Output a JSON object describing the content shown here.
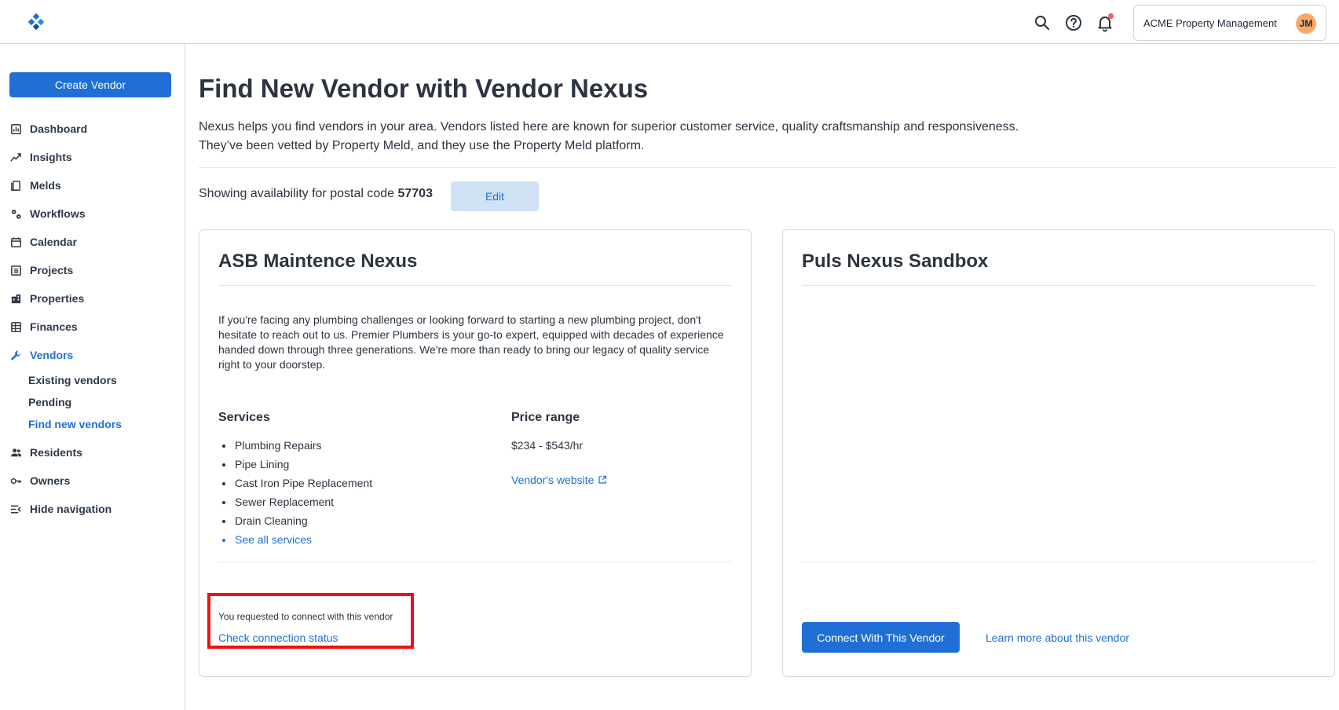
{
  "header": {
    "logo_icon": "property-meld-logo",
    "account_name": "ACME Property Management",
    "avatar_initials": "JM",
    "icons": [
      "search-icon",
      "help-icon",
      "bell-icon"
    ]
  },
  "sidebar": {
    "create_label": "Create Vendor",
    "items": [
      {
        "label": "Dashboard",
        "icon": "dashboard-icon"
      },
      {
        "label": "Insights",
        "icon": "insights-icon"
      },
      {
        "label": "Melds",
        "icon": "melds-icon"
      },
      {
        "label": "Workflows",
        "icon": "workflows-icon"
      },
      {
        "label": "Calendar",
        "icon": "calendar-icon"
      },
      {
        "label": "Projects",
        "icon": "projects-icon"
      },
      {
        "label": "Properties",
        "icon": "properties-icon"
      },
      {
        "label": "Finances",
        "icon": "finances-icon"
      },
      {
        "label": "Vendors",
        "icon": "wrench-icon"
      },
      {
        "label": "Residents",
        "icon": "residents-icon"
      },
      {
        "label": "Owners",
        "icon": "key-icon"
      },
      {
        "label": "Hide navigation",
        "icon": "hide-nav-icon"
      }
    ],
    "vendor_sub": [
      "Existing vendors",
      "Pending",
      "Find new vendors"
    ]
  },
  "main": {
    "title": "Find New Vendor with Vendor Nexus",
    "intro_line1": "Nexus helps you find vendors in your area. Vendors listed here are known for superior customer service, quality craftsmanship and responsiveness.",
    "intro_line2": "They’ve been vetted by Property Meld, and they use the Property Meld platform.",
    "postal_prefix": "Showing availability for postal code ",
    "postal_code": "57703",
    "edit_label": "Edit"
  },
  "cards": [
    {
      "title": "ASB Maintence Nexus",
      "description": "If you're facing any plumbing challenges or looking forward to starting a new plumbing project, don't hesitate to reach out to us. Premier Plumbers is your go-to expert, equipped with decades of experience handed down through three generations. We're more than ready to bring our legacy of quality service right to your doorstep.",
      "services_heading": "Services",
      "services": [
        "Plumbing Repairs",
        "Pipe Lining",
        "Cast Iron Pipe Replacement",
        "Sewer Replacement",
        "Drain Cleaning"
      ],
      "see_all": "See all services",
      "price_heading": "Price range",
      "price": "$234 - $543/hr",
      "website_label": "Vendor's website",
      "request_text": "You requested to connect with this vendor",
      "status_link": "Check connection status"
    },
    {
      "title": "Puls Nexus Sandbox",
      "connect_label": "Connect With This Vendor",
      "learn_more": "Learn more about this vendor"
    }
  ],
  "colors": {
    "primary": "#1f6fd6",
    "highlight": "#ee1111",
    "avatar": "#f7a96b"
  }
}
